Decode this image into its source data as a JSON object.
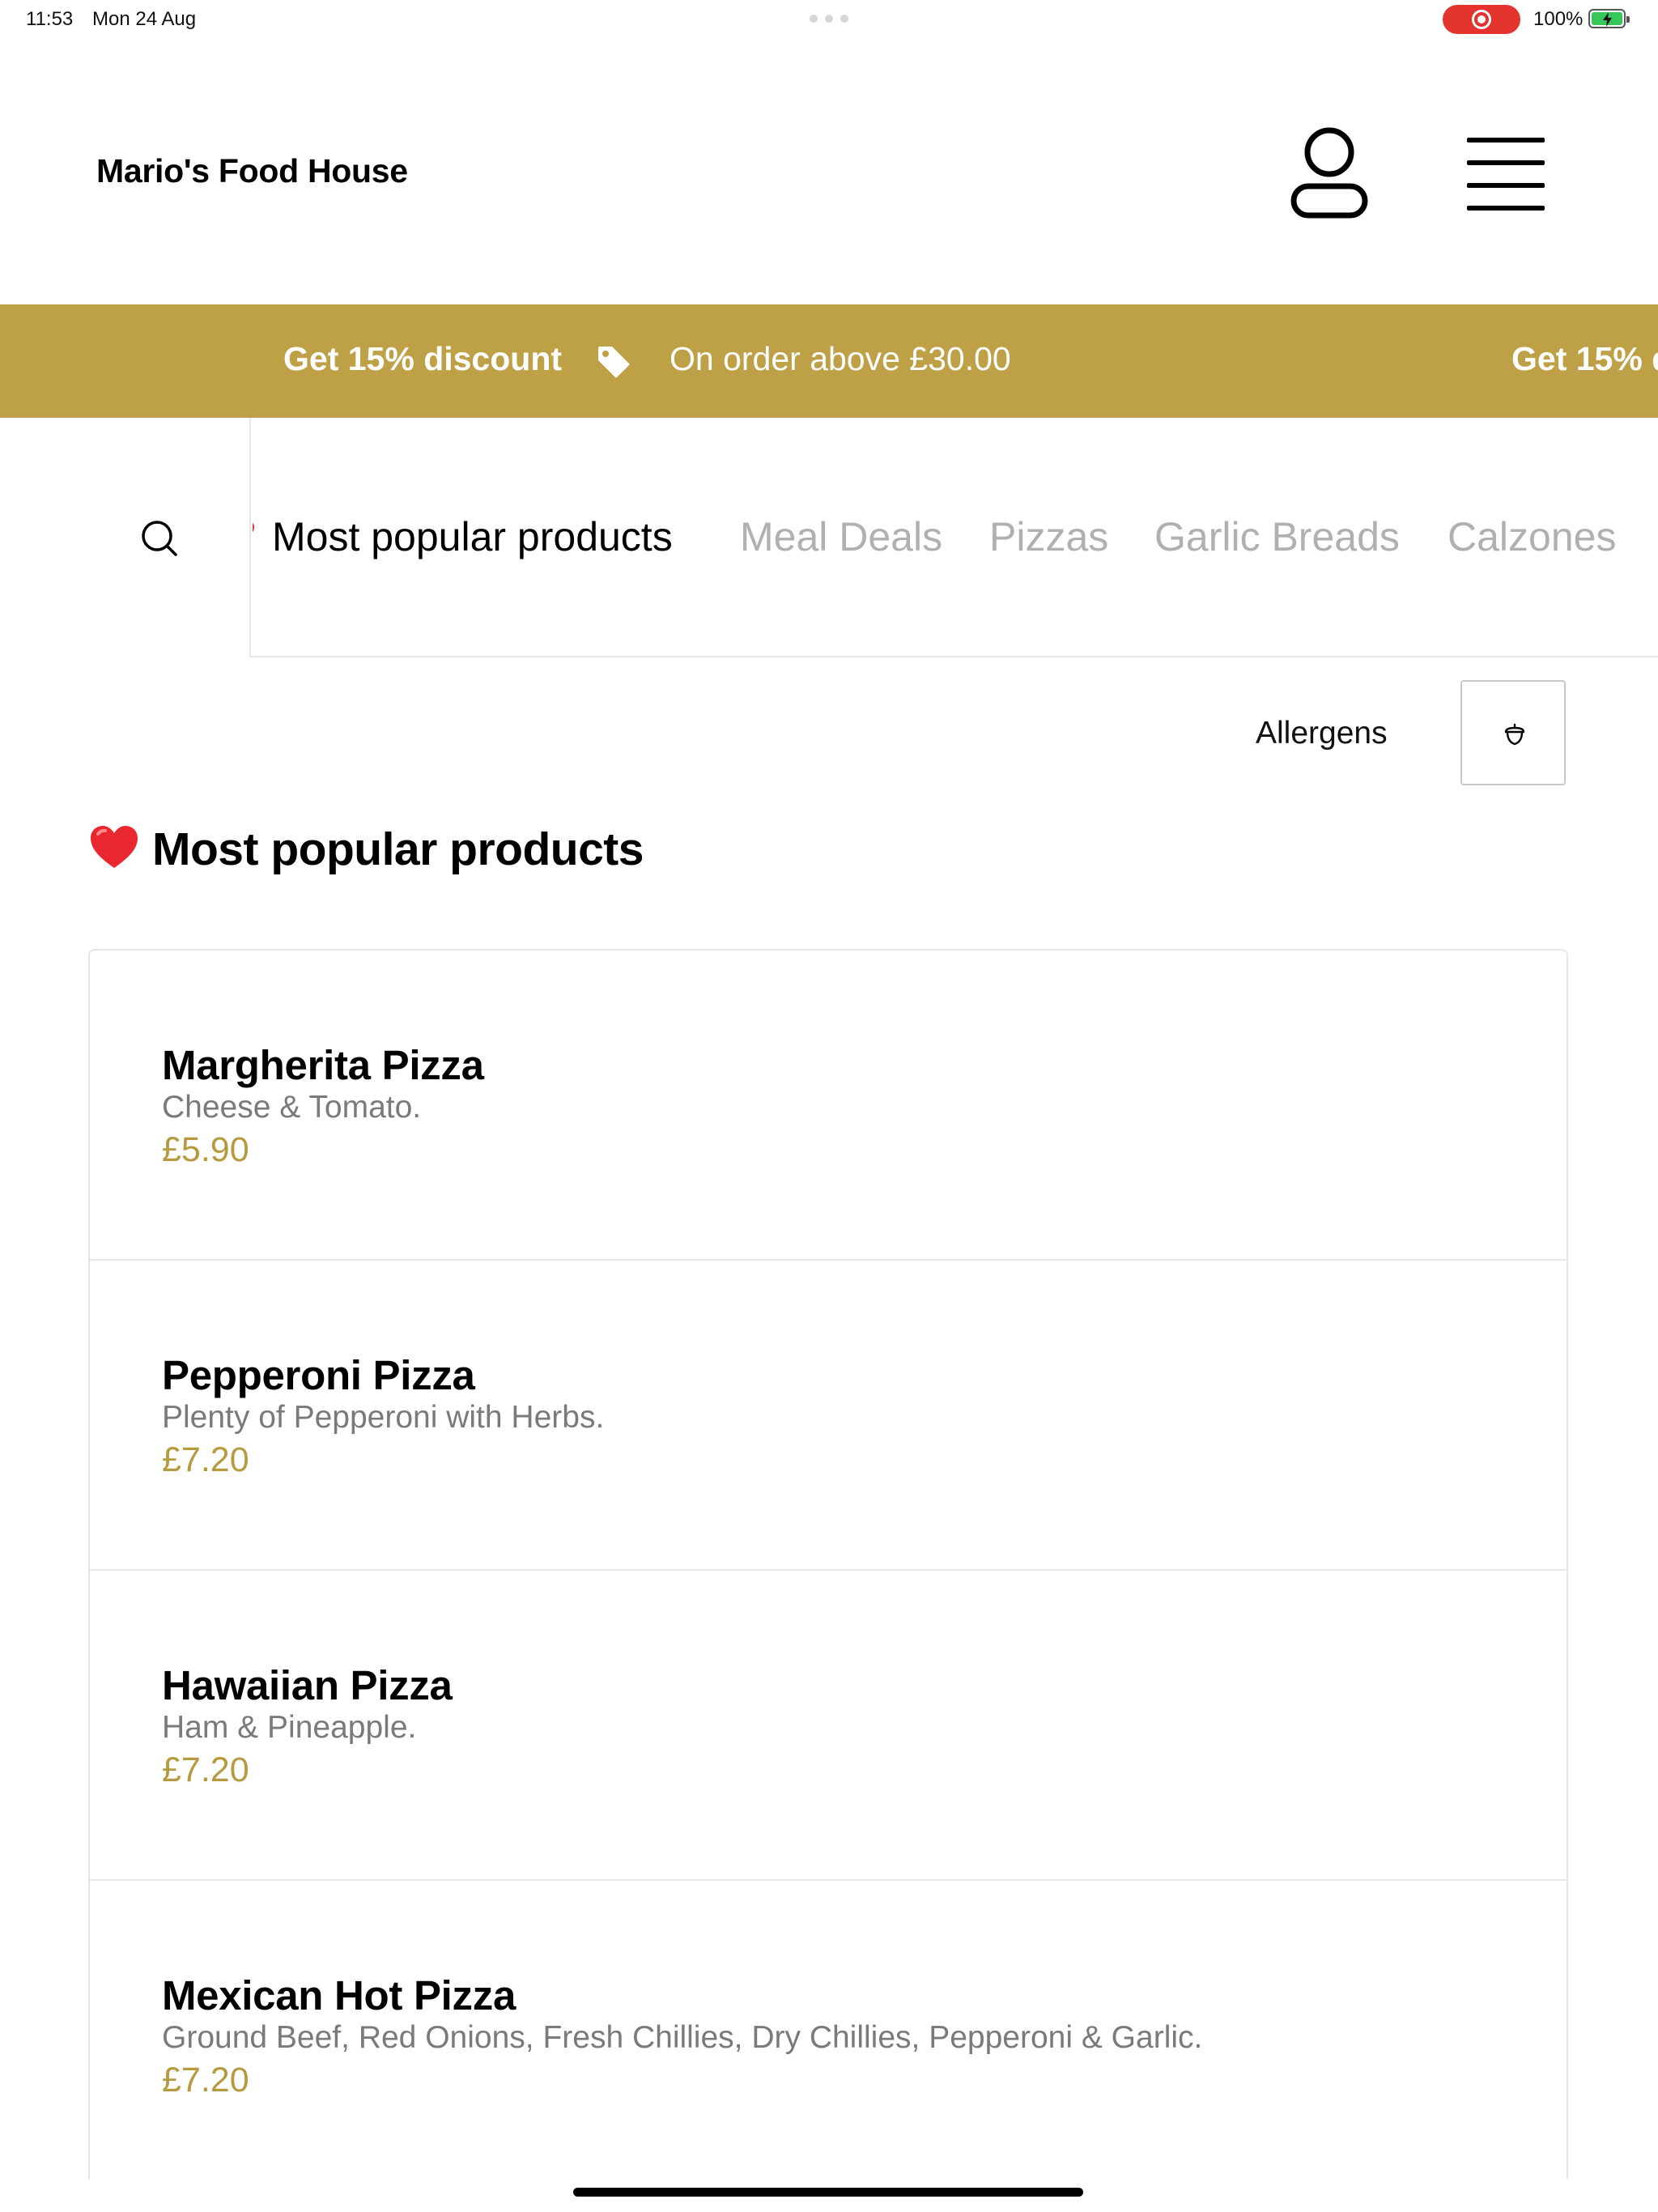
{
  "status_bar": {
    "time": "11:53",
    "date": "Mon 24 Aug",
    "battery": "100%",
    "recording_color": "#e2342d"
  },
  "header": {
    "brand": "Mario's Food House",
    "account_icon": "user-icon",
    "menu_icon": "hamburger-menu-icon"
  },
  "promo": {
    "discount": "Get 15% discount",
    "condition": "On order above £30.00",
    "discount_repeat": "Get 15% d",
    "background": "#bea146",
    "icon": "tag-icon"
  },
  "category_nav": {
    "search_icon": "search-icon",
    "tabs": [
      {
        "label": "Most popular products",
        "active": true
      },
      {
        "label": "Meal Deals",
        "active": false
      },
      {
        "label": "Pizzas",
        "active": false
      },
      {
        "label": "Garlic Breads",
        "active": false
      },
      {
        "label": "Calzones",
        "active": false
      }
    ]
  },
  "allergens": {
    "label": "Allergens",
    "icon": "acorn-icon"
  },
  "section": {
    "heading": "Most popular products",
    "icon": "red-heart-emoji"
  },
  "products": [
    {
      "name": "Margherita Pizza",
      "description": "Cheese & Tomato.",
      "price": "£5.90"
    },
    {
      "name": "Pepperoni Pizza",
      "description": "Plenty of Pepperoni with Herbs.",
      "price": "£7.20"
    },
    {
      "name": "Hawaiian Pizza",
      "description": "Ham & Pineapple.",
      "price": "£7.20"
    },
    {
      "name": "Mexican Hot Pizza",
      "description": "Ground Beef, Red Onions, Fresh Chillies, Dry Chillies, Pepperoni & Garlic.",
      "price": "£7.20"
    }
  ],
  "colors": {
    "accent": "#bea146",
    "price": "#b59a3f",
    "muted_text": "#7a7a7a",
    "inactive_tab": "#b0b0b0"
  }
}
